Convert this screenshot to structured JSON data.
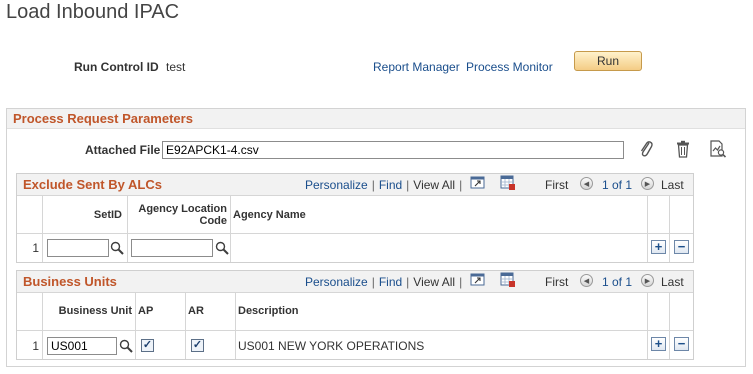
{
  "page": {
    "title": "Load Inbound IPAC"
  },
  "run_control": {
    "label": "Run Control ID",
    "value": "test"
  },
  "links": {
    "report_manager": "Report Manager",
    "process_monitor": "Process Monitor"
  },
  "run_button": "Run",
  "group": {
    "title": "Process Request Parameters"
  },
  "attached_file": {
    "label": "Attached File",
    "value": "E92APCK1-4.csv"
  },
  "icons": {
    "attach": "paperclip-icon",
    "delete": "trash-icon",
    "view": "view-file-icon",
    "lookup": "magnifier-icon",
    "download": "download-grid-icon",
    "zoom": "zoom-grid-icon"
  },
  "grid_nav": {
    "personalize": "Personalize",
    "find": "Find",
    "view_all": "View All",
    "first": "First",
    "range": "1 of 1",
    "last": "Last"
  },
  "grid1": {
    "title": "Exclude Sent By ALCs",
    "columns": {
      "setid": "SetID",
      "alc": "Agency Location Code",
      "agency_name": "Agency Name"
    },
    "rows": [
      {
        "num": "1",
        "setid": "",
        "alc": "",
        "agency_name": ""
      }
    ]
  },
  "grid2": {
    "title": "Business Units",
    "columns": {
      "bu": "Business Unit",
      "ap": "AP",
      "ar": "AR",
      "description": "Description"
    },
    "rows": [
      {
        "num": "1",
        "bu": "US001",
        "ap": true,
        "ar": true,
        "description": "US001 NEW YORK OPERATIONS"
      }
    ]
  },
  "colors": {
    "section_title": "#c0562a",
    "link": "#1a4e8c",
    "run_button": "#f4cc85"
  }
}
